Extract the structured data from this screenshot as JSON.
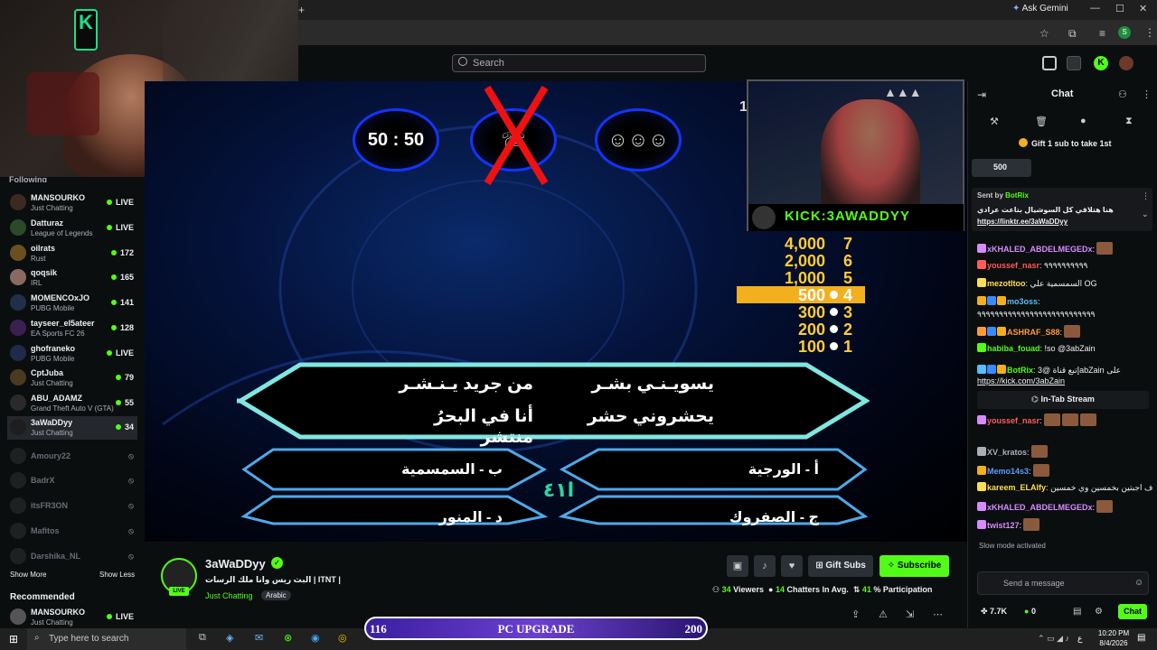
{
  "browser": {
    "gemini_label": "Ask Gemini",
    "profile_initial": "S"
  },
  "search": {
    "placeholder": "Search"
  },
  "sidebar": {
    "section_label": "Following",
    "items": [
      {
        "name": "MANSOURKO",
        "category": "Just Chatting",
        "viewers": "LIVE",
        "live": true
      },
      {
        "name": "Datturaz",
        "category": "League of Legends",
        "viewers": "LIVE",
        "live": true
      },
      {
        "name": "oilrats",
        "category": "Rust",
        "viewers": "172",
        "live": true
      },
      {
        "name": "qoqsik",
        "category": "IRL",
        "viewers": "165",
        "live": true
      },
      {
        "name": "MOMENCOxJO",
        "category": "PUBG Mobile",
        "viewers": "141",
        "live": true
      },
      {
        "name": "tayseer_el5ateer",
        "category": "EA Sports FC 26",
        "viewers": "128",
        "live": true
      },
      {
        "name": "ghofraneko",
        "category": "PUBG Mobile",
        "viewers": "LIVE",
        "live": true
      },
      {
        "name": "CptJuba",
        "category": "Just Chatting",
        "viewers": "79",
        "live": true
      },
      {
        "name": "ABU_ADAMZ",
        "category": "Grand Theft Auto V (GTA)",
        "viewers": "55",
        "live": true
      },
      {
        "name": "3aWaDDyy",
        "category": "Just Chatting",
        "viewers": "34",
        "live": true
      },
      {
        "name": "Amoury22",
        "category": "",
        "viewers": "",
        "live": false
      },
      {
        "name": "BadrX",
        "category": "",
        "viewers": "",
        "live": false
      },
      {
        "name": "itsFR3ON",
        "category": "",
        "viewers": "",
        "live": false
      },
      {
        "name": "Mafitos",
        "category": "",
        "viewers": "",
        "live": false
      },
      {
        "name": "Darshika_NL",
        "category": "",
        "viewers": "",
        "live": false
      }
    ],
    "show_more": "Show More",
    "show_less": "Show Less",
    "recommended": "Recommended",
    "rec_item": {
      "name": "MANSOURKO",
      "category": "Just Chatting",
      "viewers": "LIVE"
    }
  },
  "game": {
    "lifeline_5050": "50 : 50",
    "money_ladder": [
      {
        "amount": "4,000",
        "level": "7",
        "current": false,
        "bullet": false
      },
      {
        "amount": "2,000",
        "level": "6",
        "current": false,
        "bullet": false
      },
      {
        "amount": "1,000",
        "level": "5",
        "current": false,
        "bullet": false
      },
      {
        "amount": "500",
        "level": "4",
        "current": true,
        "bullet": true
      },
      {
        "amount": "300",
        "level": "3",
        "current": false,
        "bullet": true
      },
      {
        "amount": "200",
        "level": "2",
        "current": false,
        "bullet": true
      },
      {
        "amount": "100",
        "level": "1",
        "current": false,
        "bullet": true
      }
    ],
    "question_right_1": "يسويـنـي بشـر",
    "question_left_1": "من جريد يـنـشـر",
    "question_right_2": "يحشروني حشر",
    "question_left_2": "أنا في البحرُ منتشر",
    "answer_a": "أ - الورجية",
    "answer_b": "ب - السمسمية",
    "answer_c": "ج - الصفروك",
    "answer_d": "د - المنور",
    "center_logo": "ا٤١"
  },
  "overlay": {
    "kick_handle": "KICK:3AWADDYY",
    "side_number": "1"
  },
  "poll": {
    "left": "116",
    "title": "PC UPGRADE",
    "right": "200"
  },
  "channel": {
    "name": "3aWaDDyy",
    "title": "البث ريس وانا ملك الرسات | ITNT |",
    "category": "Just Chatting",
    "tag": "Arabic",
    "live_label": "LIVE",
    "gift_subs": "Gift Subs",
    "subscribe": "Subscribe",
    "viewers": "34",
    "viewers_label": "Viewers",
    "chatters": "14",
    "chatters_label": "Chatters In Avg.",
    "participation": "41",
    "participation_label": "% Participation"
  },
  "chat": {
    "header": "Chat",
    "gift_banner": "Gift 1 sub to take 1st",
    "leader_amount": "500",
    "pinned_label": "Sent by",
    "pinned_user": "BotRix",
    "pinned_text": "هنا هتلاقي كل السوشيال بتاعت عرادي",
    "pinned_link": "https://linktr.ee/3aWaDDyy",
    "messages": [
      {
        "user": "xKHALED_ABDELMEGEDx",
        "color": "#d78bff",
        "text": ":"
      },
      {
        "user": "youssef_nasr",
        "color": "#ff5c5c",
        "text": ": ٩٩٩٩٩٩٩٩٩٩"
      },
      {
        "user": "mezotltoo",
        "color": "#ffdd55",
        "text": ": السمسمية علي OG"
      },
      {
        "user": "mo3oss",
        "color": "#53c0ff",
        "text": ":"
      },
      {
        "user": "ASHRAF_S88",
        "color": "#ff9a3c",
        "text": ":"
      },
      {
        "user": "habiba_fouad",
        "color": "#53fc18",
        "text": ": !so @3abZain"
      },
      {
        "user": "BotRix",
        "color": "#53fc18",
        "text": ": إتبع قناة @3abZain على"
      },
      {
        "user": "youssef_nasr",
        "color": "#ff5c5c",
        "text": ":"
      },
      {
        "user": "XV_kratos",
        "color": "#adadb8",
        "text": ":"
      },
      {
        "user": "Memo14s3",
        "color": "#5c9cff",
        "text": ":"
      },
      {
        "user": "kareem_ELAlfy",
        "color": "#ffdd55",
        "text": ": احذف اجبتين بخمسين وي خمسين"
      },
      {
        "user": "xKHALED_ABDELMEGEDx",
        "color": "#d78bff",
        "text": ":"
      },
      {
        "user": "twist127",
        "color": "#d78bff",
        "text": ":"
      }
    ],
    "long_text": "٩٩٩٩٩٩٩٩٩٩٩٩٩٩٩٩٩٩٩٩٩٩٩٩٩٩٩",
    "botrix_link": "https://kick.com/3abZain",
    "in_tab": "In-Tab Stream",
    "slow_mode": "Slow mode activated",
    "placeholder": "Send a message",
    "kicks": "7.7K",
    "zero": "0",
    "chat_button": "Chat",
    "badge_14": "14",
    "badge_12": "12"
  },
  "taskbar": {
    "search": "Type here to search",
    "time": "10:20 PM",
    "date": "8/4/2026",
    "lang": "ع"
  },
  "colors": {
    "kick_green": "#53fc18",
    "gold": "#f2b01e",
    "lifeline_blue": "#1234ff"
  }
}
